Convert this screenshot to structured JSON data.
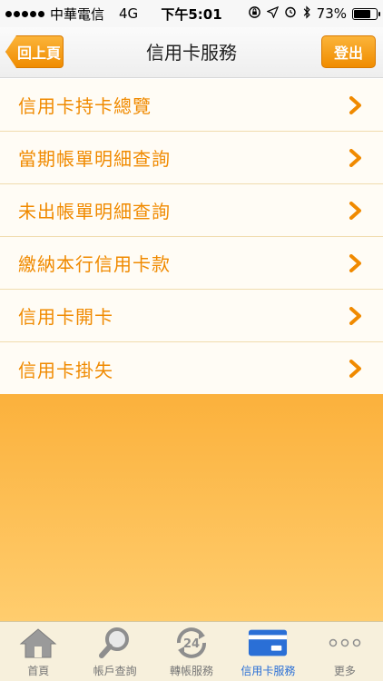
{
  "status_bar": {
    "carrier": "中華電信",
    "network": "4G",
    "time": "下午5:01",
    "battery_percent": "73%",
    "battery_level": 0.73
  },
  "nav": {
    "back_label": "回上頁",
    "title": "信用卡服務",
    "logout_label": "登出"
  },
  "menu": {
    "items": [
      {
        "label": "信用卡持卡總覽"
      },
      {
        "label": "當期帳單明細查詢"
      },
      {
        "label": "未出帳單明細查詢"
      },
      {
        "label": "繳納本行信用卡款"
      },
      {
        "label": "信用卡開卡"
      },
      {
        "label": "信用卡掛失"
      }
    ]
  },
  "tabs": [
    {
      "label": "首頁",
      "icon": "home-icon"
    },
    {
      "label": "帳戶查詢",
      "icon": "magnifier-icon"
    },
    {
      "label": "轉帳服務",
      "icon": "transfer-24-icon",
      "badge": "24"
    },
    {
      "label": "信用卡服務",
      "icon": "credit-card-icon",
      "active": true
    },
    {
      "label": "更多",
      "icon": "more-dots-icon"
    }
  ],
  "colors": {
    "accent": "#f08a00",
    "tab_active": "#2a6fd6"
  }
}
